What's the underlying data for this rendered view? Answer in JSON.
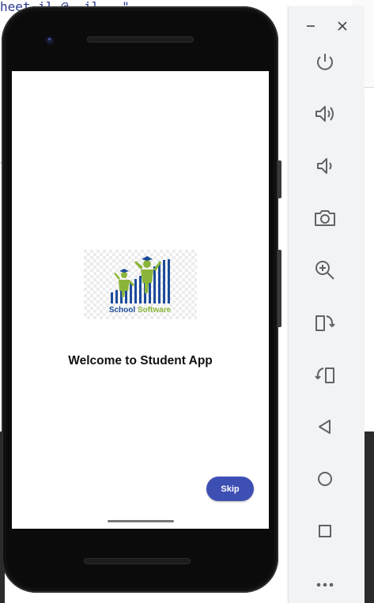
{
  "background": {
    "code_fragment": "heet il @  il   \""
  },
  "app": {
    "logo_text": "School Software",
    "welcome_text": "Welcome to Student App",
    "skip_label": "Skip",
    "colors": {
      "primary": "#3e4fb4",
      "logo_green": "#8bb53a",
      "logo_blue": "#1c4c9a"
    }
  },
  "emulator_toolbar": {
    "window_controls": [
      "minimize-icon",
      "close-icon"
    ],
    "buttons": [
      "power-icon",
      "volume-up-icon",
      "volume-down-icon",
      "camera-icon",
      "zoom-in-icon",
      "rotate-left-icon",
      "rotate-right-icon",
      "back-icon",
      "home-icon",
      "overview-icon",
      "more-icon"
    ]
  }
}
